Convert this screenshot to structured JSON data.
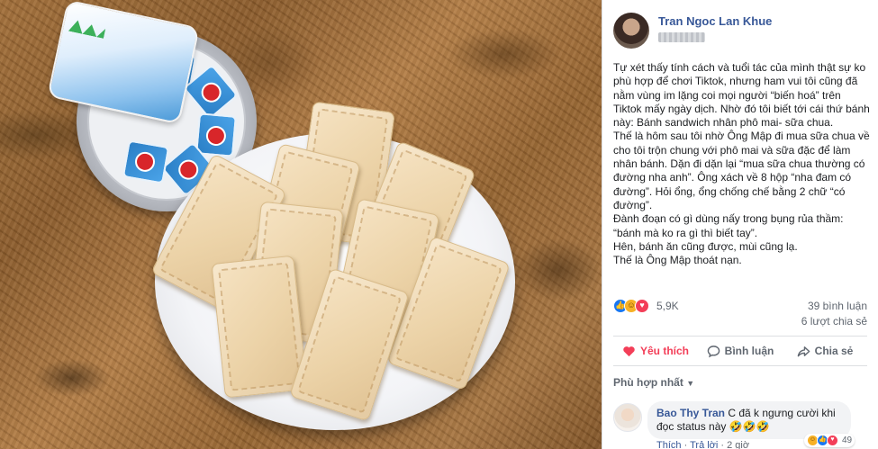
{
  "post": {
    "author": "Tran Ngoc Lan Khue",
    "body": "Tự xét thấy tính cách và tuổi tác của mình thật sự ko phù hợp để chơi Tiktok, nhưng ham vui tôi cũng đã nằm vùng im lặng coi mọi người “biến hoá” trên Tiktok mấy ngày dịch. Nhờ đó tôi biết tới cái thứ bánh này: Bánh sandwich nhân phô mai- sữa chua.\nThế là hôm sau tôi nhờ Ông Mập đi mua sữa chua về cho tôi trộn chung với phô mai và sữa đặc để làm nhân bánh. Dặn đi dặn lại “mua sữa chua thường có đường nha anh”. Ông xách về 8 hộp “nha đam có đường”. Hỏi ổng, ổng chống chế bằng 2 chữ “có đường”.\nĐành đoạn có gì dùng nấy trong bụng rủa thầm: “bánh mà ko ra gì thì biết tay”.\nHên, bánh ăn cũng được, mùi cũng lạ.\nThế là Ông Mập thoát nạn."
  },
  "stats": {
    "reactions": "5,9K",
    "comments": "39 bình luận",
    "shares": "6 lượt chia sẻ"
  },
  "actions": {
    "like": "Yêu thích",
    "comment": "Bình luận",
    "share": "Chia sẻ"
  },
  "filter": {
    "label": "Phù hợp nhất"
  },
  "comment": {
    "name": "Bao Thy Tran",
    "text": "C đã k ngưng cười khi đọc status này 🤣🤣🤣",
    "reaction_count": "49",
    "like_link": "Thích",
    "reply_link": "Trả lời",
    "time": "2 giờ"
  },
  "colors": {
    "link_blue": "#385898",
    "love_red": "#f33e58",
    "like_blue": "#1877f2",
    "haha_yellow": "#f7b125"
  },
  "icons": [
    "heart-icon",
    "comment-icon",
    "share-icon",
    "like-reaction-icon",
    "haha-reaction-icon",
    "love-reaction-icon",
    "caret-down-icon"
  ]
}
